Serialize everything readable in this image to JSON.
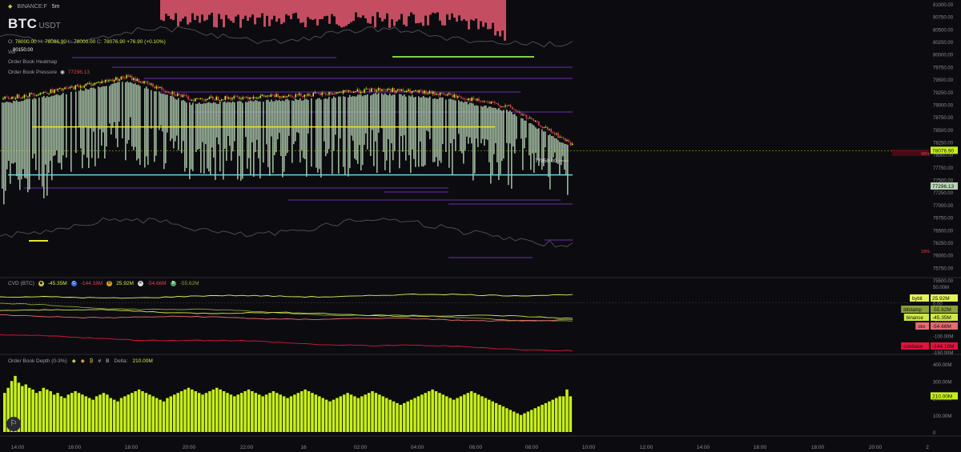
{
  "header": {
    "exchange": "BINANCE:F",
    "interval": "5m",
    "symbol_base": "BTC",
    "symbol_quote": "USDT",
    "ohlc_prefix": "O:",
    "open": "78000.00",
    "high_prefix": "H:",
    "high": "78086.90",
    "low_prefix": "L:",
    "low": "78000.00",
    "close_prefix": "C:",
    "close": "78076.90",
    "change": "+76.90",
    "change_pct": "(+0.10%)"
  },
  "indicators": {
    "vol_label": "Vol",
    "heatmap_label": "Order Book Heatmap",
    "pressure_label": "Order Book Pressure",
    "pressure_value": "77296.13",
    "top_overlay_value": "80150.00"
  },
  "main_chart": {
    "price_axis_ticks": [
      "81000.00",
      "80750.00",
      "80500.00",
      "80250.00",
      "80000.00",
      "79750.00",
      "79500.00",
      "79250.00",
      "79000.00",
      "78750.00",
      "78500.00",
      "78250.00",
      "78000.00",
      "77750.00",
      "77500.00",
      "77250.00",
      "77000.00",
      "76750.00",
      "76500.00",
      "76250.00",
      "76000.00",
      "75750.00",
      "75500.00"
    ],
    "last_price_tag": "78076.90",
    "pressure_tag": "77296.13",
    "annotation_price": "77850.00",
    "pct_label_top": "98%",
    "pct_label_bottom": "18%"
  },
  "cvd": {
    "label": "CVD (BTC)",
    "items": [
      {
        "icon": "binance-icon",
        "value": "-45.35M",
        "color": "#cfe84a"
      },
      {
        "icon": "coinbase-icon",
        "value": "-144.18M",
        "color": "#e0414f"
      },
      {
        "icon": "bybit-icon",
        "value": "25.92M",
        "color": "#cfe84a"
      },
      {
        "icon": "okx-icon",
        "value": "-54.66M",
        "color": "#e0414f"
      },
      {
        "icon": "bitstamp-icon",
        "value": "-55.62M",
        "color": "#8aa03a"
      }
    ],
    "axis_ticks": [
      "50.00M",
      "0.00",
      "-50.00M",
      "-100.00M",
      "-150.00M"
    ],
    "tags": [
      {
        "name": "bybit",
        "value": "25.92M",
        "color": "#e6f25a"
      },
      {
        "name": "bitstamp",
        "value": "-55.62M",
        "color": "#8aa03a"
      },
      {
        "name": "binance",
        "value": "-45.35M",
        "color": "#cfe84a"
      },
      {
        "name": "okx",
        "value": "-54.66M",
        "color": "#e86a72"
      },
      {
        "name": "coinbase",
        "value": "-144.18M",
        "color": "#e0143c"
      }
    ]
  },
  "depth": {
    "label": "Order Book Depth (0-3%)",
    "delta_label": "Delta:",
    "delta_value": "210.00M",
    "axis_ticks": [
      "400.00M",
      "300.00M",
      "200.00M",
      "100.00M",
      "0"
    ],
    "tag": "210.00M"
  },
  "time_axis": [
    "14:00",
    "16:00",
    "18:00",
    "20:00",
    "22:00",
    "16",
    "02:00",
    "04:00",
    "06:00",
    "08:00",
    "10:00",
    "12:00",
    "14:00",
    "16:00",
    "18:00",
    "20:00",
    "2"
  ],
  "colors": {
    "background": "#0c0c10",
    "accent_lime": "#c8f018",
    "bear_red": "#e0414f",
    "band_fill": "#b7d3b4",
    "level_yellow": "#e6e62a",
    "level_cyan": "#6fd3d8",
    "heat_purple": "#6a2fb0",
    "top_red_fill": "#d9546a"
  },
  "chart_data": [
    {
      "type": "line",
      "title": "",
      "description_series": "BTCUSDT 5m candles with order book pressure band",
      "x": [
        "14:00",
        "16:00",
        "18:00",
        "20:00",
        "22:00",
        "16",
        "02:00",
        "04:00",
        "06:00",
        "08:00"
      ],
      "series": [
        {
          "values": [
            79100,
            79300,
            79550,
            79100,
            79150,
            79200,
            79300,
            79200,
            78950,
            78200
          ]
        }
      ],
      "ylim": [
        75500,
        81000
      ],
      "levels": [
        78550,
        77850
      ]
    },
    {
      "type": "line",
      "title": "CVD (BTC)",
      "series": [
        {
          "name": "bybit",
          "final": 25.92
        },
        {
          "name": "bitstamp",
          "final": -55.62
        },
        {
          "name": "binance",
          "final": -45.35
        },
        {
          "name": "okx",
          "final": -54.66
        },
        {
          "name": "coinbase",
          "final": -144.18
        }
      ],
      "ylim": [
        -150,
        50
      ]
    },
    {
      "type": "bar",
      "title": "Order Book Depth (0-3%)",
      "values": [
        230,
        260,
        300,
        330,
        290,
        270,
        280,
        260,
        250,
        230,
        240,
        260,
        250,
        240,
        220,
        230,
        210,
        200,
        220,
        230,
        240,
        230,
        220,
        210,
        200,
        190,
        210,
        220,
        230,
        220,
        200,
        190,
        180,
        200,
        210,
        220,
        230,
        240,
        250,
        240,
        230,
        220,
        210,
        200,
        190,
        180,
        200,
        210,
        220,
        230,
        240,
        250,
        260,
        250,
        240,
        230,
        220,
        230,
        240,
        250,
        260,
        250,
        240,
        230,
        220,
        210,
        220,
        230,
        240,
        250,
        240,
        230,
        220,
        210,
        220,
        230,
        240,
        230,
        220,
        210,
        200,
        210,
        220,
        230,
        240,
        250,
        240,
        230,
        220,
        210,
        200,
        190,
        180,
        190,
        200,
        210,
        220,
        230,
        220,
        210,
        200,
        210,
        220,
        230,
        240,
        230,
        220,
        210,
        200,
        190,
        180,
        170,
        160,
        170,
        180,
        190,
        200,
        210,
        220,
        230,
        240,
        250,
        240,
        230,
        220,
        210,
        200,
        190,
        200,
        210,
        220,
        230,
        240,
        230,
        220,
        210,
        200,
        190,
        180,
        170,
        160,
        150,
        140,
        130,
        120,
        110,
        100,
        110,
        120,
        130,
        140,
        150,
        160,
        170,
        180,
        190,
        200,
        210,
        210,
        250,
        210
      ],
      "ylim": [
        0,
        400
      ]
    }
  ]
}
